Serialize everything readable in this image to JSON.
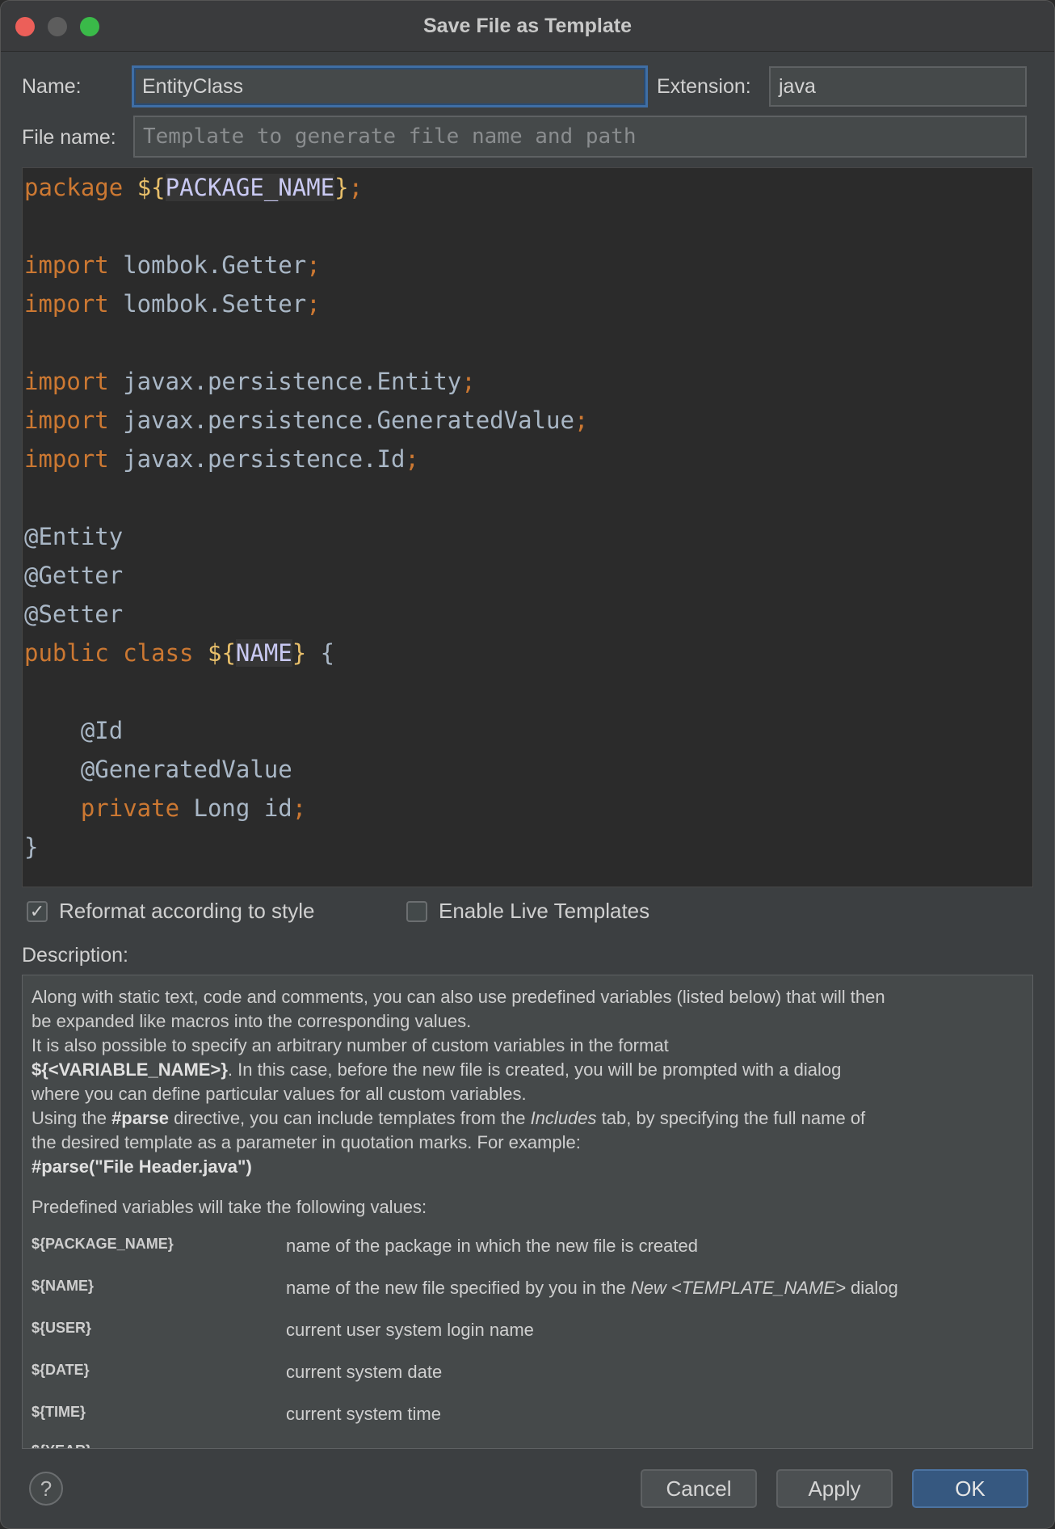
{
  "window": {
    "title": "Save File as Template"
  },
  "form": {
    "name_label": "Name:",
    "name_value": "EntityClass",
    "extension_label": "Extension:",
    "extension_value": "java",
    "filename_label": "File name:",
    "filename_placeholder": "Template to generate file name and path"
  },
  "editor": {
    "lines": [
      "package ${PACKAGE_NAME};",
      "",
      "import lombok.Getter;",
      "import lombok.Setter;",
      "",
      "import javax.persistence.Entity;",
      "import javax.persistence.GeneratedValue;",
      "import javax.persistence.Id;",
      "",
      "@Entity",
      "@Getter",
      "@Setter",
      "public class ${NAME} {",
      "",
      "    @Id",
      "    @GeneratedValue",
      "    private Long id;",
      "}"
    ]
  },
  "options": {
    "reformat_label": "Reformat according to style",
    "reformat_checked": true,
    "live_templates_label": "Enable Live Templates",
    "live_templates_checked": false
  },
  "description": {
    "label": "Description:",
    "para1_line1": "Along with static text, code and comments, you can also use predefined variables (listed below) that will then",
    "para1_line2": "be expanded like macros into the corresponding values.",
    "para2_line1": "It is also possible to specify an arbitrary number of custom variables in the format",
    "para2_line2_bold": "${<VARIABLE_NAME>}",
    "para2_line2_rest": ". In this case, before the new file is created, you will be prompted with a dialog",
    "para2_line3": "where you can define particular values for all custom variables.",
    "para3_line1_a": "Using the ",
    "para3_line1_bold": "#parse",
    "para3_line1_b": " directive, you can include templates from the ",
    "para3_line1_italic": "Includes",
    "para3_line1_c": " tab, by specifying the full name of",
    "para3_line2": "the desired template as a parameter in quotation marks. For example:",
    "para3_example": "#parse(\"File Header.java\")",
    "predefined_intro": "Predefined variables will take the following values:",
    "variables": [
      {
        "name": "${PACKAGE_NAME}",
        "desc": "name of the package in which the new file is created"
      },
      {
        "name": "${NAME}",
        "desc_a": "name of the new file specified by you in the ",
        "desc_italic": "New <TEMPLATE_NAME>",
        "desc_b": " dialog"
      },
      {
        "name": "${USER}",
        "desc": "current user system login name"
      },
      {
        "name": "${DATE}",
        "desc": "current system date"
      },
      {
        "name": "${TIME}",
        "desc": "current system time"
      },
      {
        "name": "${YEAR}",
        "desc": ""
      }
    ]
  },
  "buttons": {
    "help": "?",
    "cancel": "Cancel",
    "apply": "Apply",
    "ok": "OK"
  },
  "colors": {
    "keyword": "#cc7832",
    "template_var": "#e8bf6a",
    "plain": "#a9b7c6",
    "ok_button": "#365880"
  }
}
